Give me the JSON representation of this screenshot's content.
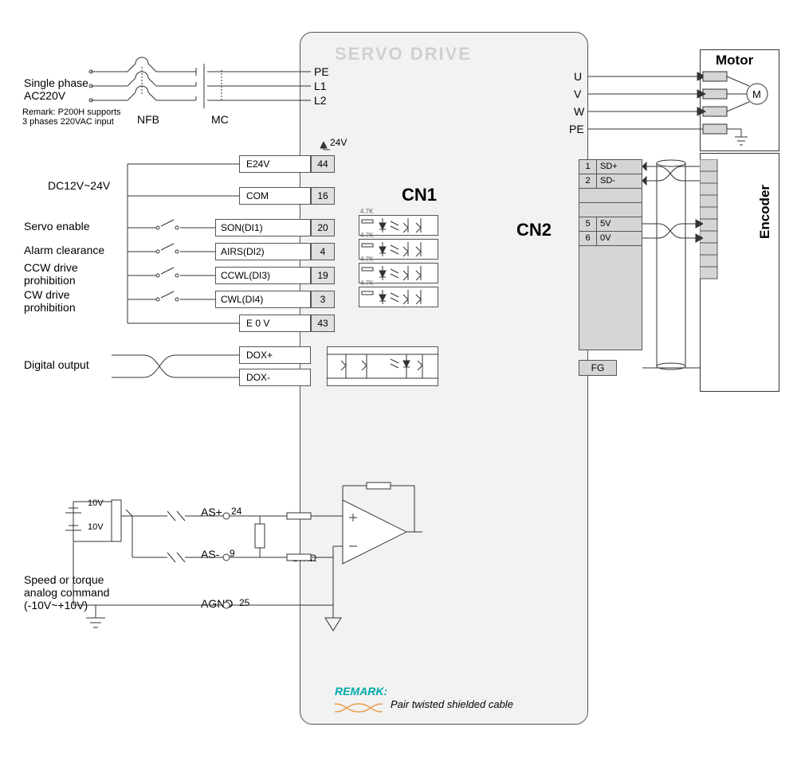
{
  "drive": {
    "title": "SERVO DRIVE",
    "connectors": {
      "cn1": "CN1",
      "cn2": "CN2"
    },
    "power_terminals": {
      "pe": "PE",
      "l1": "L1",
      "l2": "L2",
      "u": "U",
      "v": "V",
      "w": "W",
      "pe2": "PE"
    },
    "cn1_terminals": [
      {
        "name": "E24V",
        "pin": "44"
      },
      {
        "name": "COM",
        "pin": "16"
      },
      {
        "name": "SON(DI1)",
        "pin": "20"
      },
      {
        "name": "AIRS(DI2)",
        "pin": "4"
      },
      {
        "name": "CCWL(DI3)",
        "pin": "19"
      },
      {
        "name": "CWL(DI4)",
        "pin": "3"
      },
      {
        "name": "E 0 V",
        "pin": "43"
      },
      {
        "name": "DOX+",
        "pin": ""
      },
      {
        "name": "DOX-",
        "pin": ""
      }
    ],
    "analog": {
      "asplus": "AS+",
      "asplus_pin": "24",
      "asminus": "AS-",
      "asminus_pin": "9",
      "agnd": "AGND",
      "agnd_pin": "25",
      "resistor": "10KΩ"
    },
    "cn2_terminals": [
      {
        "pin": "1",
        "name": "SD+"
      },
      {
        "pin": "2",
        "name": "SD-"
      },
      {
        "pin": "5",
        "name": "5V"
      },
      {
        "pin": "6",
        "name": "0V"
      }
    ],
    "fg": "FG",
    "v24": "24V",
    "optores": "4.7K"
  },
  "inputs": {
    "power": {
      "label": "Single phase\nAC220V",
      "remark": "Remark: P200H supports\n3 phases 220VAC input",
      "nfb": "NFB",
      "mc": "MC"
    },
    "dc": "DC12V~24V",
    "di": [
      "Servo enable",
      "Alarm clearance",
      "CCW drive\nprohibition",
      "CW drive\nprohibition"
    ],
    "doutput": "Digital output",
    "analog": {
      "label": "Speed or torque\nanalog command\n(-10V~+10V)",
      "v10a": "10V",
      "v10b": "10V"
    }
  },
  "motor": {
    "title": "Motor",
    "symbol": "M"
  },
  "encoder": {
    "title": "Encoder"
  },
  "remark": {
    "label": "REMARK:",
    "text": "Pair twisted shielded cable"
  }
}
